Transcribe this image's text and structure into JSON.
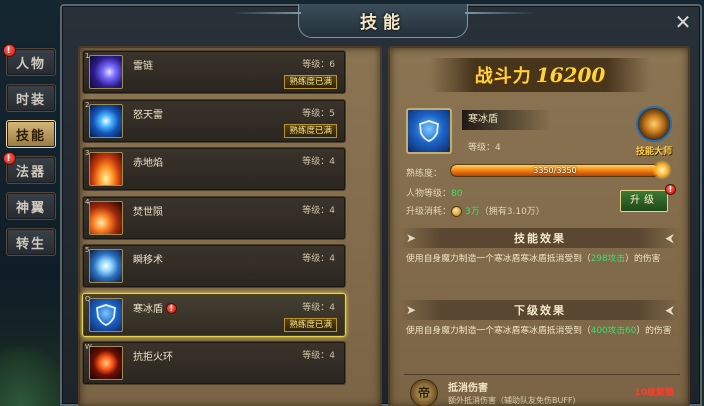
{
  "window": {
    "title": "技能",
    "close_symbol": "✕"
  },
  "side_tabs": [
    {
      "label": "人物",
      "badge": "!",
      "active": false
    },
    {
      "label": "时装",
      "badge": "",
      "active": false
    },
    {
      "label": "技能",
      "badge": "",
      "active": true
    },
    {
      "label": "法器",
      "badge": "!",
      "active": false
    },
    {
      "label": "神翼",
      "badge": "",
      "active": false
    },
    {
      "label": "转生",
      "badge": "",
      "active": false
    }
  ],
  "skills": [
    {
      "index": "1",
      "name": "雷链",
      "level": "等级：6",
      "mastery": "熟练度已满",
      "icon": "thunder-icon"
    },
    {
      "index": "2",
      "name": "怒天雷",
      "level": "等级：5",
      "mastery": "熟练度已满",
      "icon": "lightning-icon"
    },
    {
      "index": "3",
      "name": "赤地焰",
      "level": "等级：4",
      "mastery": "",
      "icon": "fire-icon"
    },
    {
      "index": "4",
      "name": "焚世陨",
      "level": "等级：4",
      "mastery": "",
      "icon": "meteor-icon"
    },
    {
      "index": "5",
      "name": "瞬移术",
      "level": "等级：4",
      "mastery": "",
      "icon": "teleport-icon"
    },
    {
      "index": "Q",
      "name": "寒冰盾",
      "level": "等级：4",
      "mastery": "熟练度已满",
      "icon": "ice-shield-icon",
      "selected": true,
      "badge": "!"
    },
    {
      "index": "W",
      "name": "抗拒火环",
      "level": "等级：4",
      "mastery": "",
      "icon": "fire-ring-icon"
    }
  ],
  "detail": {
    "power_label": "战斗力",
    "power_value": "16200",
    "skill_name": "寒冰盾",
    "skill_level": "等级：4",
    "master_label": "技能大师",
    "exp_label": "熟练度：",
    "exp_text": "3350/3350",
    "exp_fraction": 1.0,
    "char_level_label": "人物等级：",
    "char_level_value": "80",
    "cost_label": "升级消耗：",
    "cost_value": "3万",
    "cost_owned": "（拥有3.10万）",
    "upgrade_label": "升级",
    "upgrade_badge": "!"
  },
  "effect": {
    "title": "技能效果",
    "text_prefix": "使用自身魔力制造一个寒冰盾寒冰盾抵消受到（",
    "text_highlight": "298攻击",
    "text_suffix": "）的伤害"
  },
  "next_effect": {
    "title": "下级效果",
    "text_prefix": "使用自身魔力制造一个寒冰盾寒冰盾抵消受到（",
    "text_highlight": "400攻击60",
    "text_suffix": "）的伤害"
  },
  "next_skill": {
    "icon_char": "帝",
    "title": "抵消伤害",
    "desc": "额外抵消伤害（辅助队友免伤BUFF）",
    "requirement": "10级解锁"
  },
  "colors": {
    "highlight": "#3ae06a",
    "gold": "#ffd43a",
    "alert": "#ff3b2a"
  }
}
